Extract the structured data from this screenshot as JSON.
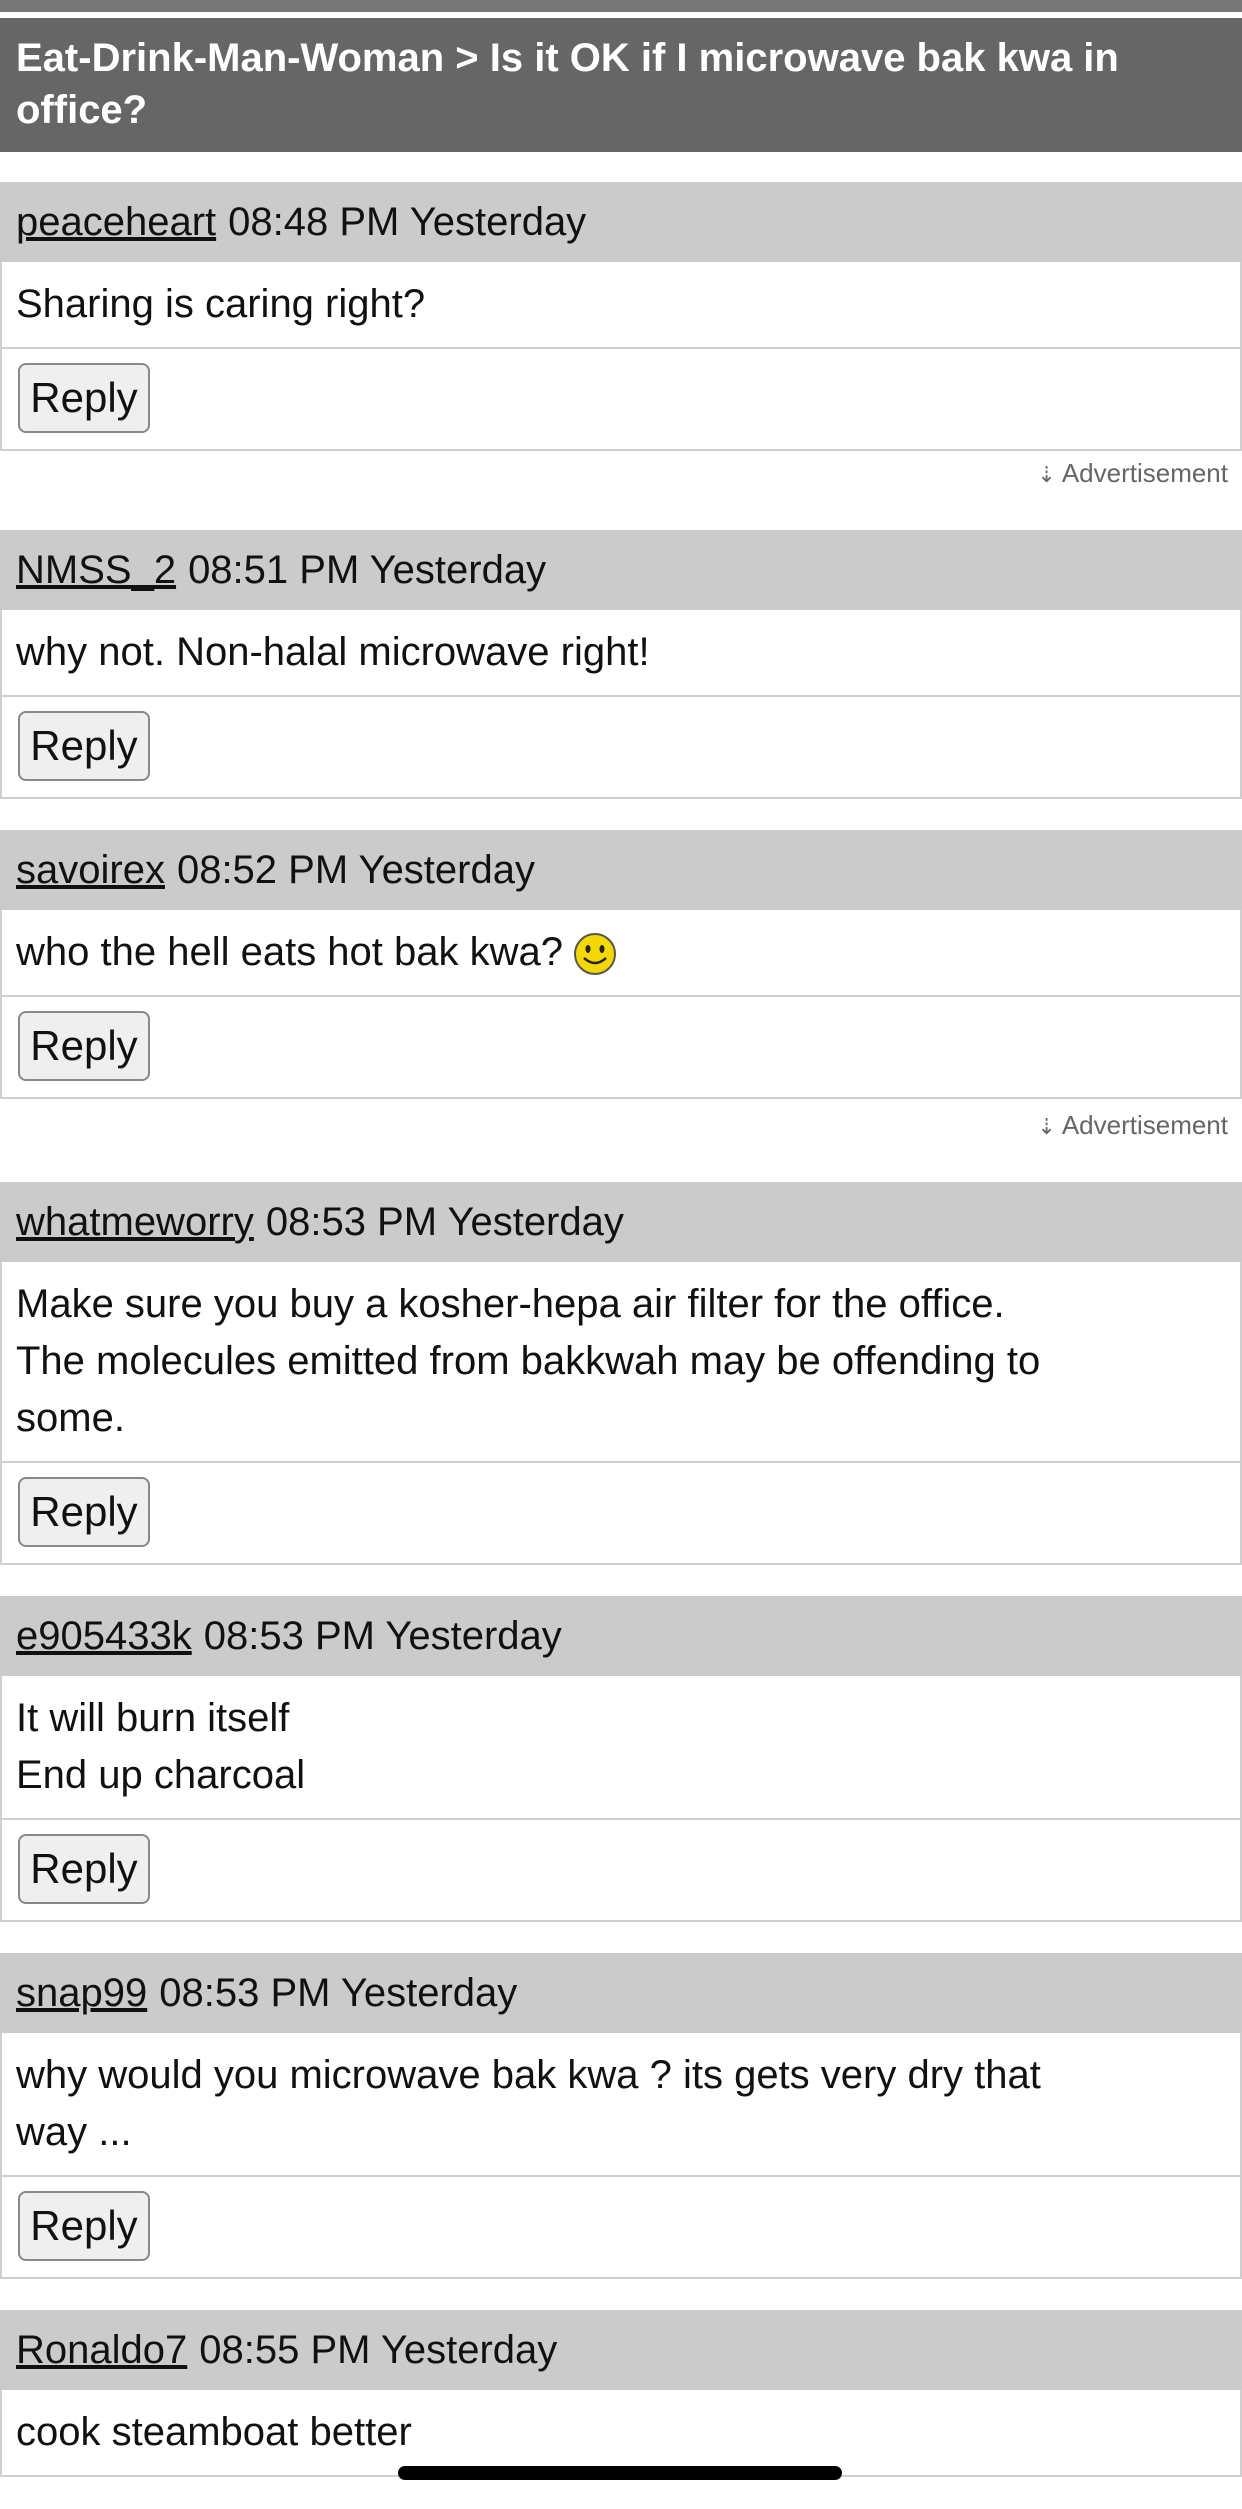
{
  "header": {
    "breadcrumb": "Eat-Drink-Man-Woman > Is it OK if I microwave bak kwa in office?"
  },
  "reply_label": "Reply",
  "ad_label": "Advertisement",
  "posts": [
    {
      "user": "peaceheart",
      "time": "08:48 PM Yesterday",
      "lines": [
        "Sharing is caring right?"
      ]
    },
    {
      "user": "NMSS_2",
      "time": "08:51 PM Yesterday",
      "lines": [
        "why not. Non-halal microwave right!"
      ]
    },
    {
      "user": "savoirex",
      "time": "08:52 PM Yesterday",
      "lines": [
        "who the hell eats hot bak kwa?"
      ],
      "emoji": "smiley-icon"
    },
    {
      "user": "whatmeworry",
      "time": "08:53 PM Yesterday",
      "lines": [
        "Make sure you buy a kosher-hepa air filter for the office.",
        "The molecules emitted from bakkwah may be offending to",
        "some."
      ]
    },
    {
      "user": "e905433k",
      "time": "08:53 PM Yesterday",
      "lines": [
        "It will burn itself",
        "End up charcoal"
      ]
    },
    {
      "user": "snap99",
      "time": "08:53 PM Yesterday",
      "lines": [
        "why would you microwave bak kwa ? its gets very dry that",
        "way ..."
      ]
    },
    {
      "user": "Ronaldo7",
      "time": "08:55 PM Yesterday",
      "lines": [
        "cook steamboat better"
      ]
    }
  ],
  "colors": {
    "title_bg": "#666666",
    "post_head_bg": "#cbcbcb",
    "smiley": "#f5d800"
  }
}
